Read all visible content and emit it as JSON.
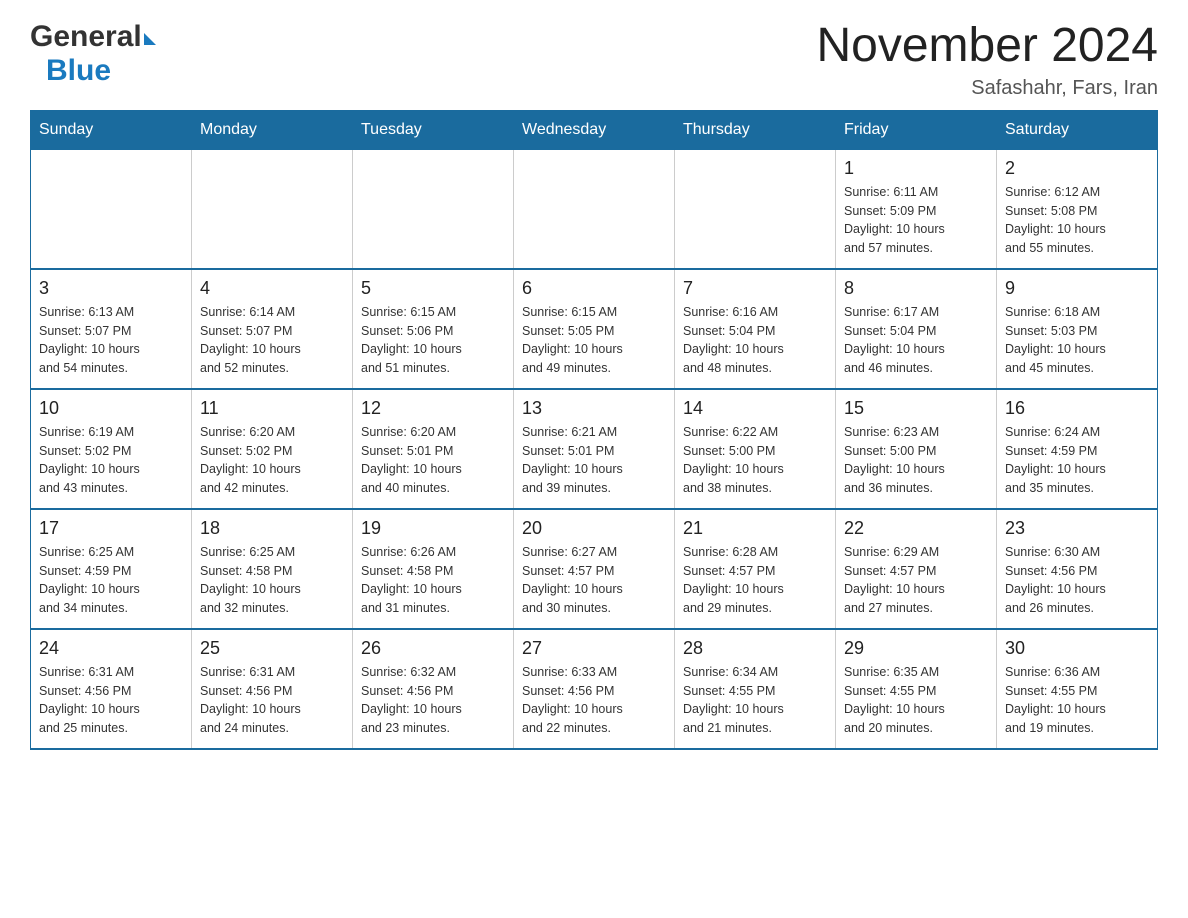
{
  "header": {
    "logo": {
      "general": "General",
      "blue": "Blue"
    },
    "title": "November 2024",
    "subtitle": "Safashahr, Fars, Iran"
  },
  "calendar": {
    "days_of_week": [
      "Sunday",
      "Monday",
      "Tuesday",
      "Wednesday",
      "Thursday",
      "Friday",
      "Saturday"
    ],
    "weeks": [
      [
        {
          "day": "",
          "info": ""
        },
        {
          "day": "",
          "info": ""
        },
        {
          "day": "",
          "info": ""
        },
        {
          "day": "",
          "info": ""
        },
        {
          "day": "",
          "info": ""
        },
        {
          "day": "1",
          "info": "Sunrise: 6:11 AM\nSunset: 5:09 PM\nDaylight: 10 hours\nand 57 minutes."
        },
        {
          "day": "2",
          "info": "Sunrise: 6:12 AM\nSunset: 5:08 PM\nDaylight: 10 hours\nand 55 minutes."
        }
      ],
      [
        {
          "day": "3",
          "info": "Sunrise: 6:13 AM\nSunset: 5:07 PM\nDaylight: 10 hours\nand 54 minutes."
        },
        {
          "day": "4",
          "info": "Sunrise: 6:14 AM\nSunset: 5:07 PM\nDaylight: 10 hours\nand 52 minutes."
        },
        {
          "day": "5",
          "info": "Sunrise: 6:15 AM\nSunset: 5:06 PM\nDaylight: 10 hours\nand 51 minutes."
        },
        {
          "day": "6",
          "info": "Sunrise: 6:15 AM\nSunset: 5:05 PM\nDaylight: 10 hours\nand 49 minutes."
        },
        {
          "day": "7",
          "info": "Sunrise: 6:16 AM\nSunset: 5:04 PM\nDaylight: 10 hours\nand 48 minutes."
        },
        {
          "day": "8",
          "info": "Sunrise: 6:17 AM\nSunset: 5:04 PM\nDaylight: 10 hours\nand 46 minutes."
        },
        {
          "day": "9",
          "info": "Sunrise: 6:18 AM\nSunset: 5:03 PM\nDaylight: 10 hours\nand 45 minutes."
        }
      ],
      [
        {
          "day": "10",
          "info": "Sunrise: 6:19 AM\nSunset: 5:02 PM\nDaylight: 10 hours\nand 43 minutes."
        },
        {
          "day": "11",
          "info": "Sunrise: 6:20 AM\nSunset: 5:02 PM\nDaylight: 10 hours\nand 42 minutes."
        },
        {
          "day": "12",
          "info": "Sunrise: 6:20 AM\nSunset: 5:01 PM\nDaylight: 10 hours\nand 40 minutes."
        },
        {
          "day": "13",
          "info": "Sunrise: 6:21 AM\nSunset: 5:01 PM\nDaylight: 10 hours\nand 39 minutes."
        },
        {
          "day": "14",
          "info": "Sunrise: 6:22 AM\nSunset: 5:00 PM\nDaylight: 10 hours\nand 38 minutes."
        },
        {
          "day": "15",
          "info": "Sunrise: 6:23 AM\nSunset: 5:00 PM\nDaylight: 10 hours\nand 36 minutes."
        },
        {
          "day": "16",
          "info": "Sunrise: 6:24 AM\nSunset: 4:59 PM\nDaylight: 10 hours\nand 35 minutes."
        }
      ],
      [
        {
          "day": "17",
          "info": "Sunrise: 6:25 AM\nSunset: 4:59 PM\nDaylight: 10 hours\nand 34 minutes."
        },
        {
          "day": "18",
          "info": "Sunrise: 6:25 AM\nSunset: 4:58 PM\nDaylight: 10 hours\nand 32 minutes."
        },
        {
          "day": "19",
          "info": "Sunrise: 6:26 AM\nSunset: 4:58 PM\nDaylight: 10 hours\nand 31 minutes."
        },
        {
          "day": "20",
          "info": "Sunrise: 6:27 AM\nSunset: 4:57 PM\nDaylight: 10 hours\nand 30 minutes."
        },
        {
          "day": "21",
          "info": "Sunrise: 6:28 AM\nSunset: 4:57 PM\nDaylight: 10 hours\nand 29 minutes."
        },
        {
          "day": "22",
          "info": "Sunrise: 6:29 AM\nSunset: 4:57 PM\nDaylight: 10 hours\nand 27 minutes."
        },
        {
          "day": "23",
          "info": "Sunrise: 6:30 AM\nSunset: 4:56 PM\nDaylight: 10 hours\nand 26 minutes."
        }
      ],
      [
        {
          "day": "24",
          "info": "Sunrise: 6:31 AM\nSunset: 4:56 PM\nDaylight: 10 hours\nand 25 minutes."
        },
        {
          "day": "25",
          "info": "Sunrise: 6:31 AM\nSunset: 4:56 PM\nDaylight: 10 hours\nand 24 minutes."
        },
        {
          "day": "26",
          "info": "Sunrise: 6:32 AM\nSunset: 4:56 PM\nDaylight: 10 hours\nand 23 minutes."
        },
        {
          "day": "27",
          "info": "Sunrise: 6:33 AM\nSunset: 4:56 PM\nDaylight: 10 hours\nand 22 minutes."
        },
        {
          "day": "28",
          "info": "Sunrise: 6:34 AM\nSunset: 4:55 PM\nDaylight: 10 hours\nand 21 minutes."
        },
        {
          "day": "29",
          "info": "Sunrise: 6:35 AM\nSunset: 4:55 PM\nDaylight: 10 hours\nand 20 minutes."
        },
        {
          "day": "30",
          "info": "Sunrise: 6:36 AM\nSunset: 4:55 PM\nDaylight: 10 hours\nand 19 minutes."
        }
      ]
    ]
  }
}
